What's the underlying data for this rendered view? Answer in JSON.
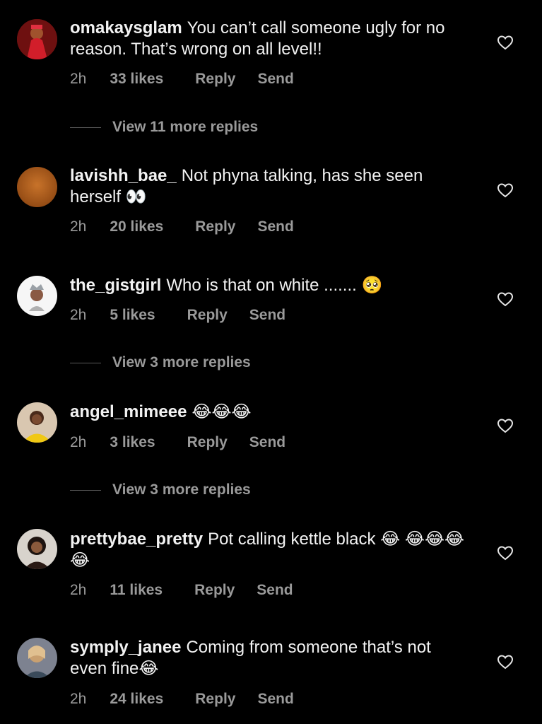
{
  "comments": [
    {
      "username": "omakaysglam",
      "text": "You can’t call someone ugly for no reason. That’s wrong on all level!!",
      "time": "2h",
      "likes": "33 likes",
      "reply": "Reply",
      "send": "Send",
      "view_replies": "View 11 more replies",
      "avatar_color": "#8b1a1a"
    },
    {
      "username": "lavishh_bae_",
      "text": "Not phyna talking, has she seen herself 👀",
      "time": "2h",
      "likes": "20 likes",
      "reply": "Reply",
      "send": "Send",
      "view_replies": "",
      "avatar_color": "#b5621f"
    },
    {
      "username": "the_gistgirl",
      "text": "Who is that on white ....... 🥺",
      "time": "2h",
      "likes": "5 likes",
      "reply": "Reply",
      "send": "Send",
      "view_replies": "View 3 more replies",
      "avatar_color": "#f4f4f4"
    },
    {
      "username": "angel_mimeee",
      "text": "😂😂😂",
      "time": "2h",
      "likes": "3 likes",
      "reply": "Reply",
      "send": "Send",
      "view_replies": "View 3 more replies",
      "avatar_color": "#e8c21a"
    },
    {
      "username": "prettybae_pretty",
      "text": "Pot calling kettle black 😂 😂😂😂😂",
      "time": "2h",
      "likes": "11 likes",
      "reply": "Reply",
      "send": "Send",
      "view_replies": "",
      "avatar_color": "#3a2a22"
    },
    {
      "username": "symply_janee",
      "text": "Coming from someone that’s not even fine😂",
      "time": "2h",
      "likes": "24 likes",
      "reply": "Reply",
      "send": "Send",
      "view_replies": "",
      "avatar_color": "#6b6f7a"
    }
  ]
}
